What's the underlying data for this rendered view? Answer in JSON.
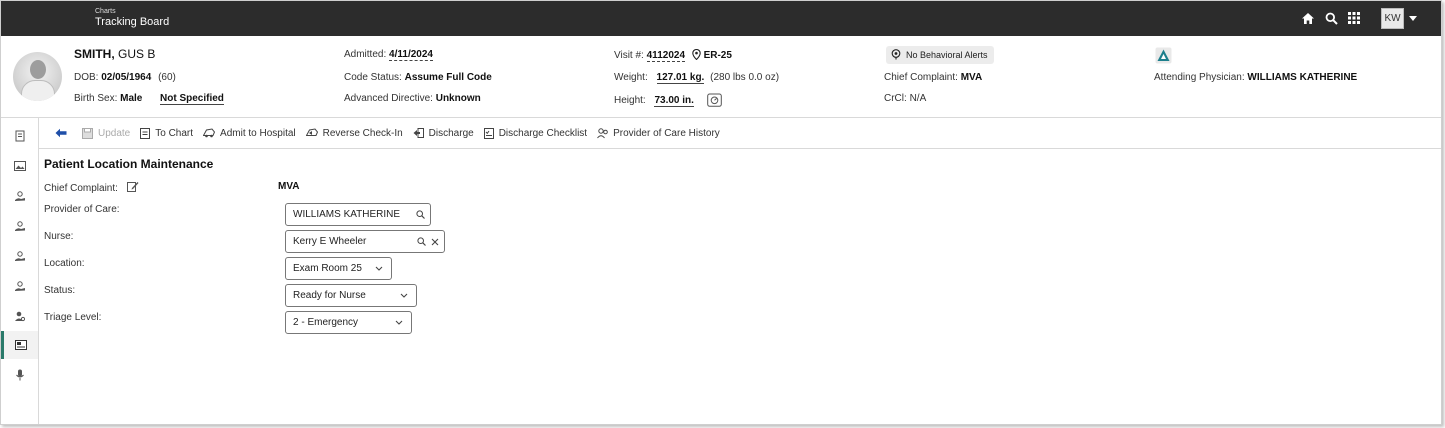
{
  "app": {
    "section": "Charts",
    "title": "Tracking Board",
    "user_initials": "KW"
  },
  "patient": {
    "last_name": "SMITH,",
    "first_name": "GUS B",
    "dob_label": "DOB:",
    "dob": "02/05/1964",
    "age": "(60)",
    "birth_sex_label": "Birth Sex:",
    "birth_sex": "Male",
    "gender_identity": "Not Specified",
    "admitted_label": "Admitted:",
    "admitted": "4/11/2024",
    "code_status_label": "Code Status:",
    "code_status": "Assume Full Code",
    "adv_directive_label": "Advanced Directive:",
    "adv_directive": "Unknown",
    "visit_label": "Visit #:",
    "visit": "4112024",
    "room": "ER-25",
    "weight_label": "Weight:",
    "weight": "127.01 kg.",
    "weight_alt": "(280 lbs 0.0 oz)",
    "height_label": "Height:",
    "height": "73.00 in.",
    "behavioral_alerts": "No Behavioral Alerts",
    "chief_complaint_label": "Chief Complaint:",
    "chief_complaint": "MVA",
    "crcl_label": "CrCl:",
    "crcl": "N/A",
    "attending_label": "Attending Physician:",
    "attending": "WILLIAMS KATHERINE"
  },
  "toolbar": {
    "update": "Update",
    "to_chart": "To Chart",
    "admit": "Admit to Hospital",
    "reverse": "Reverse Check-In",
    "discharge": "Discharge",
    "discharge_checklist": "Discharge Checklist",
    "provider_history": "Provider of Care History"
  },
  "form": {
    "title": "Patient Location Maintenance",
    "chief_complaint_label": "Chief Complaint:",
    "chief_complaint_value": "MVA",
    "provider_label": "Provider of Care:",
    "provider_value": "WILLIAMS KATHERINE",
    "nurse_label": "Nurse:",
    "nurse_value": "Kerry E Wheeler",
    "location_label": "Location:",
    "location_value": "Exam Room 25",
    "status_label": "Status:",
    "status_value": "Ready for Nurse",
    "triage_label": "Triage Level:",
    "triage_value": "2 - Emergency"
  },
  "colors": {
    "topbar": "#2c2c2c",
    "accent": "#2a7a6a",
    "triage_icon": "#1d7f8c"
  }
}
